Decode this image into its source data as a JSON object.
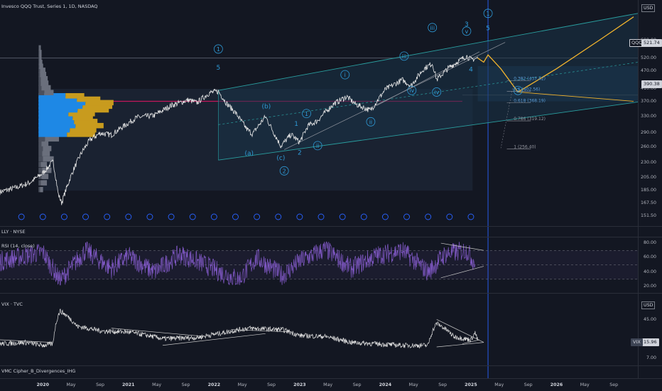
{
  "header": {
    "main_title": "Invesco QQQ Trust, Series 1, 1D, NASDAQ",
    "currency": "USD",
    "ticker_tag": "QQQ",
    "last_price": "521.74",
    "second_tag": "390.38"
  },
  "colors": {
    "background": "#131722",
    "price_line": "#e8e8e8",
    "channel": "#2a9fa0",
    "wave_label": "#2e9bd8",
    "projection": "#f2b42d",
    "rsi_line": "#7e57c2",
    "volume_profile_blue": "#1e88e5",
    "volume_profile_gold": "#c89b1e",
    "resistance": "#c2185b"
  },
  "price_axis_labels": [
    "600.00",
    "520.00",
    "470.00",
    "410.00",
    "370.00",
    "330.00",
    "290.00",
    "260.00",
    "230.00",
    "205.00",
    "185.00",
    "167.50",
    "151.50"
  ],
  "wave_labels": [
    {
      "text": "1",
      "circled": true,
      "price": 560,
      "date": 2022.05
    },
    {
      "text": "5",
      "circled": false,
      "price": 485,
      "date": 2022.05
    },
    {
      "text": "(a)",
      "circled": false,
      "price": 248,
      "date": 2022.41
    },
    {
      "text": "(b)",
      "circled": false,
      "price": 358,
      "date": 2022.61
    },
    {
      "text": "(c)",
      "circled": false,
      "price": 239,
      "date": 2022.78
    },
    {
      "text": "2",
      "circled": true,
      "price": 216,
      "date": 2022.82
    },
    {
      "text": "1",
      "circled": false,
      "price": 312,
      "date": 2022.96
    },
    {
      "text": "1",
      "circled": true,
      "price": 338,
      "date": 2023.08
    },
    {
      "text": "2",
      "circled": false,
      "price": 249,
      "date": 2023.0
    },
    {
      "text": "ii",
      "circled": true,
      "price": 263,
      "date": 2023.21
    },
    {
      "text": "i",
      "circled": true,
      "price": 458,
      "date": 2023.53
    },
    {
      "text": "ii",
      "circled": true,
      "price": 317,
      "date": 2023.83
    },
    {
      "text": "iii",
      "circled": true,
      "price": 530,
      "date": 2024.22
    },
    {
      "text": "iv",
      "circled": true,
      "price": 405,
      "date": 2024.31
    },
    {
      "text": "iii",
      "circled": true,
      "price": 662,
      "date": 2024.55
    },
    {
      "text": "iv",
      "circled": true,
      "price": 400,
      "date": 2024.6
    },
    {
      "text": "v",
      "circled": true,
      "price": 644,
      "date": 2024.95
    },
    {
      "text": "3",
      "circled": false,
      "price": 680,
      "date": 2024.95
    },
    {
      "text": "4",
      "circled": false,
      "price": 478,
      "date": 2025.0
    },
    {
      "text": "1",
      "circled": true,
      "price": 740,
      "date": 2025.2
    },
    {
      "text": "5",
      "circled": false,
      "price": 660,
      "date": 2025.2
    },
    {
      "text": "2",
      "circled": true,
      "price": 405,
      "date": 2025.55
    }
  ],
  "fib_levels": [
    {
      "label": "0.382 (437.42)",
      "price": 437.42
    },
    {
      "label": "0.5 (402.56)",
      "price": 402.56
    },
    {
      "label": "0.618 (368.19)",
      "price": 368.19
    },
    {
      "label": "0.786 (319.12)",
      "price": 319.12
    },
    {
      "label": "1 (256.40)",
      "price": 256.4
    }
  ],
  "event_markers_count": 20,
  "chart_data": [
    {
      "type": "line",
      "title": "Invesco QQQ Trust, Series 1, 1D, NASDAQ",
      "ylabel": "USD",
      "y_scale": "log",
      "ylim": [
        145,
        760
      ],
      "xlim": [
        2019.5,
        2026.95
      ],
      "x_tick_labels": [
        "2020",
        "May",
        "Sep",
        "2021",
        "May",
        "Sep",
        "2022",
        "May",
        "Sep",
        "2023",
        "May",
        "Sep",
        "2024",
        "May",
        "Sep",
        "2025",
        "May",
        "Sep",
        "2026",
        "May",
        "Sep"
      ],
      "series": [
        {
          "name": "QQQ",
          "x": [
            2019.5,
            2019.7,
            2019.85,
            2020.0,
            2020.12,
            2020.18,
            2020.22,
            2020.35,
            2020.45,
            2020.55,
            2020.67,
            2020.8,
            2020.95,
            2021.1,
            2021.3,
            2021.5,
            2021.7,
            2021.8,
            2021.95,
            2022.05,
            2022.15,
            2022.25,
            2022.38,
            2022.45,
            2022.6,
            2022.7,
            2022.78,
            2022.9,
            2023.0,
            2023.1,
            2023.2,
            2023.4,
            2023.55,
            2023.65,
            2023.83,
            2024.0,
            2024.2,
            2024.3,
            2024.45,
            2024.55,
            2024.6,
            2024.75,
            2024.95,
            2025.0,
            2025.08
          ],
          "y": [
            183,
            190,
            197,
            212,
            232,
            180,
            168,
            215,
            248,
            275,
            290,
            286,
            307,
            328,
            333,
            360,
            376,
            368,
            398,
            402,
            365,
            340,
            300,
            288,
            330,
            290,
            262,
            287,
            270,
            308,
            318,
            365,
            386,
            364,
            346,
            408,
            440,
            420,
            480,
            500,
            440,
            486,
            530,
            515,
            521.74
          ]
        },
        {
          "name": "Projection",
          "x": [
            2025.08,
            2025.15,
            2025.2,
            2025.35,
            2025.55,
            2026.0,
            2026.5,
            2026.9
          ],
          "y": [
            521.74,
            505,
            535,
            480,
            400,
            480,
            600,
            720
          ]
        }
      ],
      "annotations": [
        "1",
        "5",
        "(a)",
        "(b)",
        "(c)",
        "2",
        "i",
        "ii",
        "iii",
        "iv",
        "v",
        "3",
        "4"
      ]
    },
    {
      "type": "line",
      "title": "LLY · NYSE",
      "ylim": [
        0,
        0
      ],
      "series": []
    },
    {
      "type": "line",
      "title": "RSI (14, close)",
      "ylim": [
        18,
        86
      ],
      "y_tick_labels": [
        "80.00",
        "60.00",
        "40.00",
        "20.00"
      ],
      "bands": [
        70,
        50,
        30
      ],
      "series": [
        {
          "name": "RSI",
          "x": [
            2019.5,
            2020.0,
            2020.2,
            2020.5,
            2020.8,
            2021.0,
            2021.3,
            2021.6,
            2021.9,
            2022.1,
            2022.3,
            2022.5,
            2022.8,
            2023.0,
            2023.3,
            2023.6,
            2023.9,
            2024.2,
            2024.5,
            2024.7,
            2024.95,
            2025.05
          ],
          "y": [
            55,
            68,
            28,
            70,
            45,
            62,
            40,
            65,
            50,
            38,
            30,
            60,
            35,
            55,
            72,
            45,
            63,
            70,
            40,
            65,
            70,
            52
          ]
        }
      ]
    },
    {
      "type": "line",
      "title": "VIX · TVC",
      "ylabel": "USD",
      "y_scale": "log",
      "ylim": [
        6,
        90
      ],
      "y_tick_labels": [
        "45.00",
        "15.96",
        "7.00"
      ],
      "last_value": "15.96",
      "series": [
        {
          "name": "VIX",
          "x": [
            2019.5,
            2019.8,
            2020.0,
            2020.12,
            2020.2,
            2020.4,
            2020.7,
            2021.0,
            2021.4,
            2021.8,
            2022.1,
            2022.4,
            2022.8,
            2023.0,
            2023.3,
            2023.6,
            2023.9,
            2024.2,
            2024.5,
            2024.6,
            2024.8,
            2025.0,
            2025.05,
            2025.08
          ],
          "y": [
            14,
            15,
            13,
            14,
            70,
            33,
            26,
            25,
            18,
            19,
            24,
            30,
            28,
            21,
            20,
            15,
            14,
            13,
            13,
            38,
            20,
            17,
            24,
            15.96
          ]
        }
      ]
    },
    {
      "type": "line",
      "title": "VMC Cipher_B_Divergences_IHG",
      "series": []
    }
  ]
}
